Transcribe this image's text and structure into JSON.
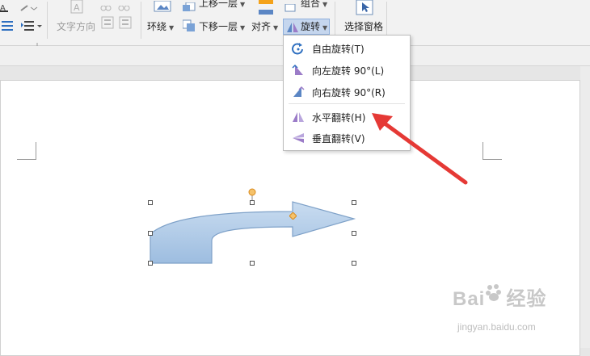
{
  "ribbon": {
    "text_direction": "文字方向",
    "up_layer": "上移一层",
    "down_layer": "下移一层",
    "wrap": "环绕",
    "align": "对齐",
    "group": "组合",
    "rotate": "旋转",
    "selection_pane": "选择窗格"
  },
  "rotate_menu": {
    "items": [
      {
        "label": "自由旋转(T)",
        "icon": "free-rotate-icon"
      },
      {
        "label": "向左旋转 90°(L)",
        "icon": "rotate-left-icon"
      },
      {
        "label": "向右旋转 90°(R)",
        "icon": "rotate-right-icon"
      },
      {
        "label": "水平翻转(H)",
        "icon": "flip-horizontal-icon"
      },
      {
        "label": "垂直翻转(V)",
        "icon": "flip-vertical-icon"
      }
    ]
  },
  "watermark": {
    "logo": "Bai",
    "logo_2": "经验",
    "url": "jingyan.baidu.com"
  },
  "colors": {
    "shape_fill_top": "#c9dcf0",
    "shape_fill_bottom": "#9dbde0",
    "shape_stroke": "#7ea1c8",
    "annotation_arrow": "#e53935",
    "highlight": "#c5d6ee"
  }
}
